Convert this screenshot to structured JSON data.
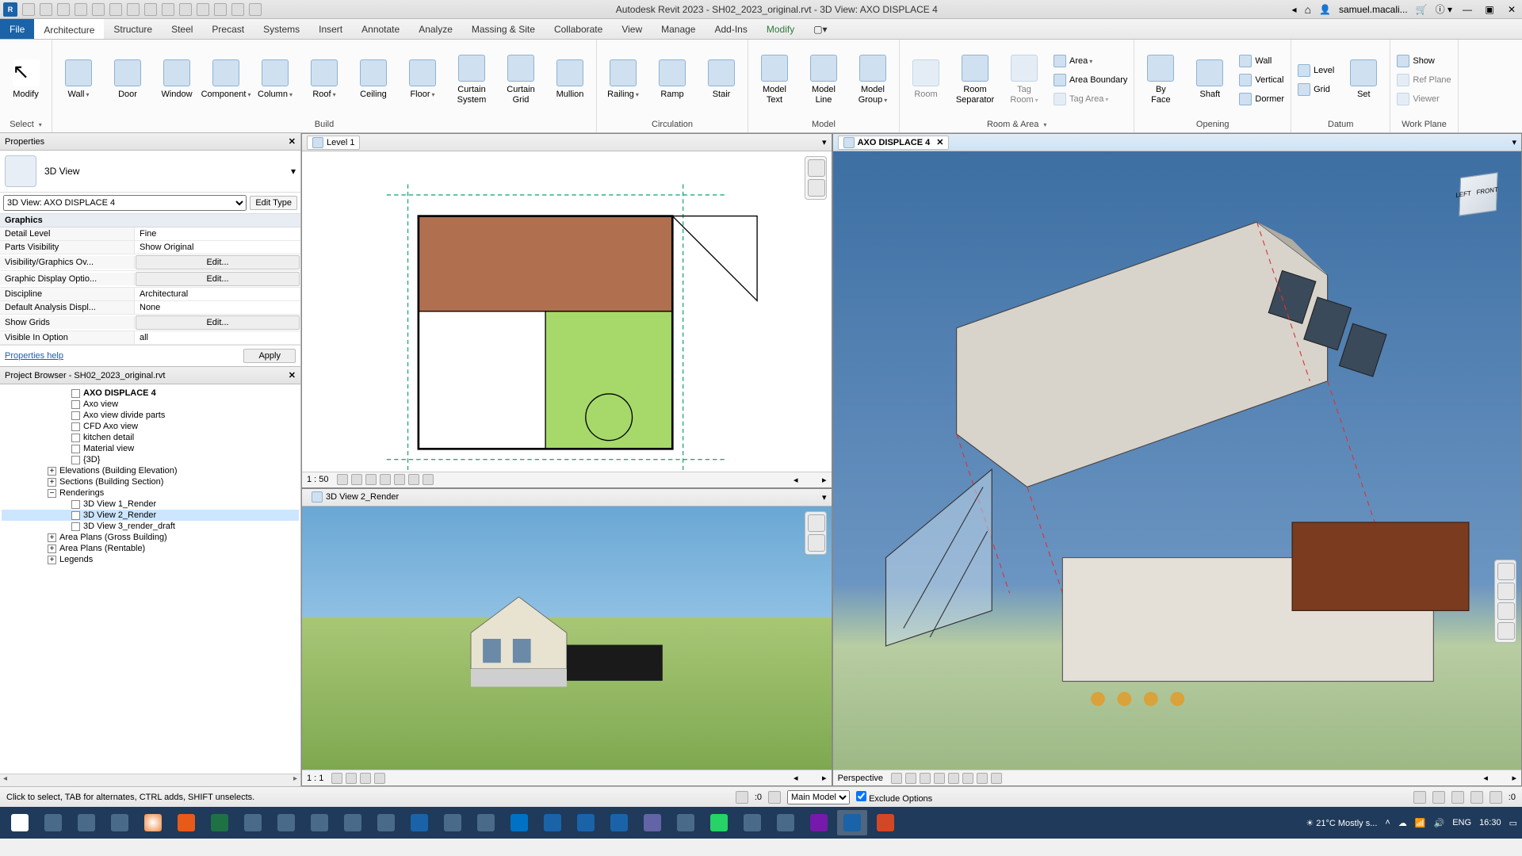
{
  "title": "Autodesk Revit 2023 - SH02_2023_original.rvt - 3D View: AXO DISPLACE 4",
  "user": "samuel.macali...",
  "tabs": {
    "file": "File",
    "list": [
      "Architecture",
      "Structure",
      "Steel",
      "Precast",
      "Systems",
      "Insert",
      "Annotate",
      "Analyze",
      "Massing & Site",
      "Collaborate",
      "View",
      "Manage",
      "Add-Ins",
      "Modify"
    ]
  },
  "ribbon": {
    "select_panel": "Select",
    "modify": "Modify",
    "select_drop": "Select",
    "panels": {
      "build": "Build",
      "circulation": "Circulation",
      "model": "Model",
      "room_area": "Room & Area",
      "opening": "Opening",
      "datum": "Datum",
      "work_plane": "Work Plane"
    },
    "build": {
      "wall": "Wall",
      "door": "Door",
      "window": "Window",
      "component": "Component",
      "column": "Column",
      "roof": "Roof",
      "ceiling": "Ceiling",
      "floor": "Floor",
      "curtain_system": "Curtain\nSystem",
      "curtain_grid": "Curtain\nGrid",
      "mullion": "Mullion"
    },
    "circulation": {
      "railing": "Railing",
      "ramp": "Ramp",
      "stair": "Stair"
    },
    "model": {
      "text": "Model\nText",
      "line": "Model\nLine",
      "group": "Model\nGroup"
    },
    "room_area": {
      "room": "Room",
      "separator": "Room\nSeparator",
      "tag_room": "Tag\nRoom",
      "area": "Area",
      "area_boundary": "Area Boundary",
      "tag_area": "Tag Area"
    },
    "opening": {
      "by_face": "By\nFace",
      "shaft": "Shaft",
      "wall": "Wall",
      "vertical": "Vertical",
      "dormer": "Dormer"
    },
    "datum": {
      "level": "Level",
      "grid": "Grid"
    },
    "work_plane": {
      "set": "Set",
      "show": "Show",
      "ref_plane": "Ref Plane",
      "viewer": "Viewer"
    }
  },
  "properties": {
    "title": "Properties",
    "type": "3D View",
    "instance": "3D View: AXO DISPLACE 4",
    "edit_type": "Edit Type",
    "group_graphics": "Graphics",
    "rows": [
      {
        "label": "Detail Level",
        "value": "Fine"
      },
      {
        "label": "Parts Visibility",
        "value": "Show Original"
      },
      {
        "label": "Visibility/Graphics Ov...",
        "value": "Edit...",
        "btn": true
      },
      {
        "label": "Graphic Display Optio...",
        "value": "Edit...",
        "btn": true
      },
      {
        "label": "Discipline",
        "value": "Architectural"
      },
      {
        "label": "Default Analysis Displ...",
        "value": "None"
      },
      {
        "label": "Show Grids",
        "value": "Edit...",
        "btn": true
      },
      {
        "label": "Visible In Option",
        "value": "all"
      }
    ],
    "help": "Properties help",
    "apply": "Apply"
  },
  "browser": {
    "title": "Project Browser - SH02_2023_original.rvt",
    "nodes": {
      "axo4": "AXO DISPLACE 4",
      "axo_view": "Axo view",
      "axo_divide": "Axo view divide parts",
      "cfd": "CFD Axo view",
      "kitchen": "kitchen detail",
      "material": "Material view",
      "threed": "{3D}",
      "elev": "Elevations (Building Elevation)",
      "sections": "Sections (Building Section)",
      "renderings": "Renderings",
      "r1": "3D View 1_Render",
      "r2": "3D View 2_Render",
      "r3": "3D View 3_render_draft",
      "area_gross": "Area Plans (Gross Building)",
      "area_rent": "Area Plans (Rentable)",
      "legends": "Legends"
    }
  },
  "views": {
    "level1": {
      "tab": "Level 1",
      "scale": "1 : 50"
    },
    "render": {
      "tab": "3D View 2_Render",
      "scale": "1 : 1"
    },
    "axo": {
      "tab": "AXO DISPLACE 4",
      "scale": "Perspective"
    }
  },
  "statusbar": {
    "hint": "Click to select, TAB for alternates, CTRL adds, SHIFT unselects.",
    "sel_count": ":0",
    "model": "Main Model",
    "exclude": "Exclude Options",
    "filter_count": ":0"
  },
  "taskbar": {
    "weather": "21°C  Mostly s...",
    "lang": "ENG",
    "time": "16:30"
  },
  "viewcube": {
    "left": "LEFT",
    "front": "FRONT"
  }
}
